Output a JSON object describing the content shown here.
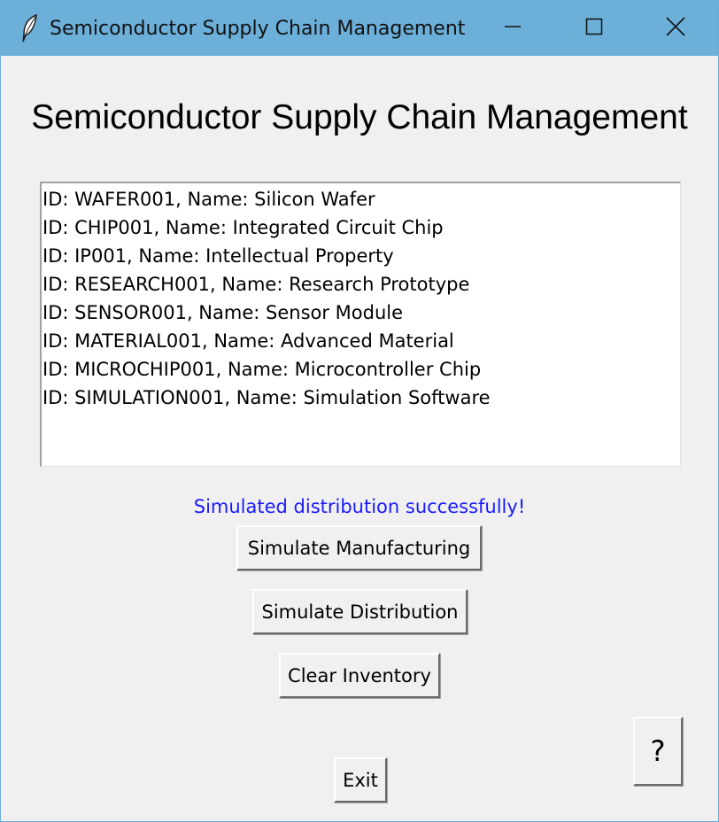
{
  "window": {
    "title": "Semiconductor Supply Chain Management",
    "controls": {
      "minimize": "minimize-icon",
      "maximize": "maximize-icon",
      "close": "close-icon"
    }
  },
  "main": {
    "heading": "Semiconductor Supply Chain Management",
    "inventory": [
      "ID: WAFER001, Name: Silicon Wafer",
      "ID: CHIP001, Name: Integrated Circuit Chip",
      "ID: IP001, Name: Intellectual Property",
      "ID: RESEARCH001, Name: Research Prototype",
      "ID: SENSOR001, Name: Sensor Module",
      "ID: MATERIAL001, Name: Advanced Material",
      "ID: MICROCHIP001, Name: Microcontroller Chip",
      "ID: SIMULATION001, Name: Simulation Software"
    ],
    "status": "Simulated distribution successfully!",
    "status_color": "#1a1aff"
  },
  "buttons": {
    "manufacture": "Simulate Manufacturing",
    "distribute": "Simulate Distribution",
    "clear": "Clear Inventory",
    "help": "?",
    "exit": "Exit"
  },
  "colors": {
    "titlebar": "#6cafd9",
    "background": "#f0f0f0"
  }
}
